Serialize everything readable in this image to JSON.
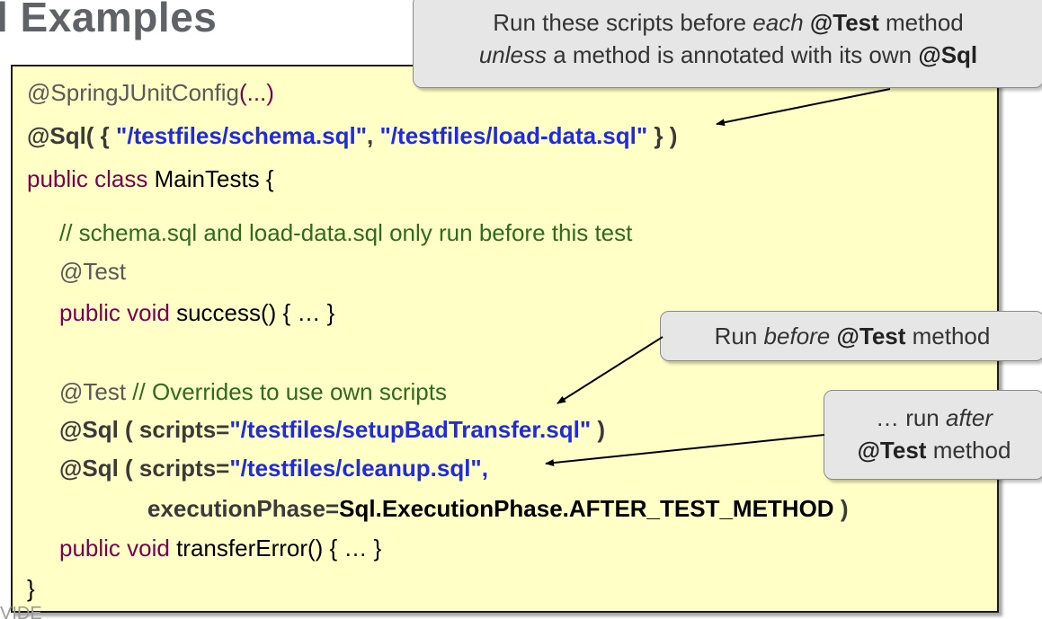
{
  "slide": {
    "title": "l Examples",
    "footer": "VIDE"
  },
  "code": {
    "l1_annot": "@SpringJUnitConfig",
    "l1_args": "(...)",
    "l2_open": "@Sql( { ",
    "l2_str1": "\"/testfiles/schema.sql\"",
    "l2_comma": ", ",
    "l2_str2": "\"/testfiles/load-data.sql\"",
    "l2_close": " } )",
    "l3_kw": "public class",
    "l3_rest": " MainTests {",
    "l4_comment": "// schema.sql and load-data.sql only run before this test",
    "l5_annot": "@Test",
    "l6_kw": "public void",
    "l6_rest": " success() {  …  }",
    "l7_annot": "@Test",
    "l7_comment": " // Overrides to use own scripts",
    "l8_open": "@Sql ( scripts=",
    "l8_str": "\"/testfiles/setupBadTransfer.sql\"",
    "l8_close": " )",
    "l9_open": "@Sql ( scripts=",
    "l9_str": "\"/testfiles/cleanup.sql\"",
    "l9_comma": ",",
    "l10_key": "executionPhase=",
    "l10_val": "Sql.ExecutionPhase.AFTER_TEST_METHOD",
    "l10_close": "  )",
    "l11_kw": "public void",
    "l11_rest": " transferError() { …  }",
    "l12_brace": "}"
  },
  "callouts": {
    "top": {
      "l1_pre": "Run these scripts before ",
      "l1_em": "each",
      "l1_sp": " ",
      "l1_b": "@Test",
      "l1_post": " method",
      "l2_em": "unless",
      "l2_mid": " a method is annotated with its own ",
      "l2_b": "@Sql"
    },
    "before": {
      "pre": "Run ",
      "em": "before",
      "sp": " ",
      "b": "@Test",
      "post": " method"
    },
    "after": {
      "l1_pre": "… run ",
      "l1_em": "after",
      "l2_b": "@Test",
      "l2_post": " method"
    }
  }
}
